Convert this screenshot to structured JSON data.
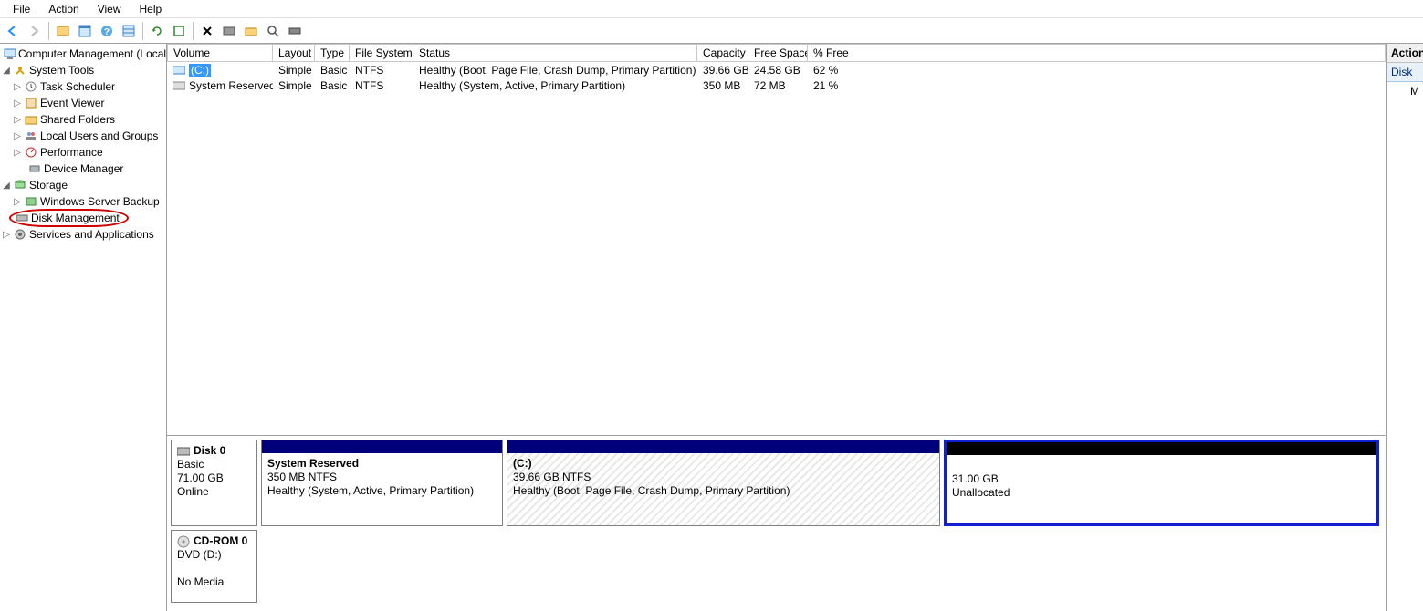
{
  "menubar": {
    "file": "File",
    "action": "Action",
    "view": "View",
    "help": "Help"
  },
  "tree": {
    "root": "Computer Management (Local",
    "system_tools": "System Tools",
    "task_scheduler": "Task Scheduler",
    "event_viewer": "Event Viewer",
    "shared_folders": "Shared Folders",
    "local_users": "Local Users and Groups",
    "performance": "Performance",
    "device_manager": "Device Manager",
    "storage": "Storage",
    "ws_backup": "Windows Server Backup",
    "disk_management": "Disk Management",
    "services_apps": "Services and Applications"
  },
  "vol_headers": {
    "volume": "Volume",
    "layout": "Layout",
    "type": "Type",
    "fs": "File System",
    "status": "Status",
    "capacity": "Capacity",
    "free": "Free Space",
    "pfree": "% Free"
  },
  "volumes": [
    {
      "name": "(C:)",
      "layout": "Simple",
      "type": "Basic",
      "fs": "NTFS",
      "status": "Healthy (Boot, Page File, Crash Dump, Primary Partition)",
      "capacity": "39.66 GB",
      "free": "24.58 GB",
      "pfree": "62 %",
      "selected": true
    },
    {
      "name": "System Reserved",
      "layout": "Simple",
      "type": "Basic",
      "fs": "NTFS",
      "status": "Healthy (System, Active, Primary Partition)",
      "capacity": "350 MB",
      "free": "72 MB",
      "pfree": "21 %",
      "selected": false
    }
  ],
  "disks": {
    "disk0": {
      "title": "Disk 0",
      "type": "Basic",
      "size": "71.00 GB",
      "state": "Online",
      "parts": {
        "sysres": {
          "title": "System Reserved",
          "size_fs": "350 MB NTFS",
          "status": "Healthy (System, Active, Primary Partition)"
        },
        "c": {
          "title": "(C:)",
          "size_fs": "39.66 GB NTFS",
          "status": "Healthy (Boot, Page File, Crash Dump, Primary Partition)"
        },
        "unalloc": {
          "size": "31.00 GB",
          "status": "Unallocated"
        }
      }
    },
    "cd0": {
      "title": "CD-ROM 0",
      "sub": "DVD (D:)",
      "state": "No Media"
    }
  },
  "actions": {
    "header": "Action",
    "disk": "Disk",
    "more": "M"
  }
}
